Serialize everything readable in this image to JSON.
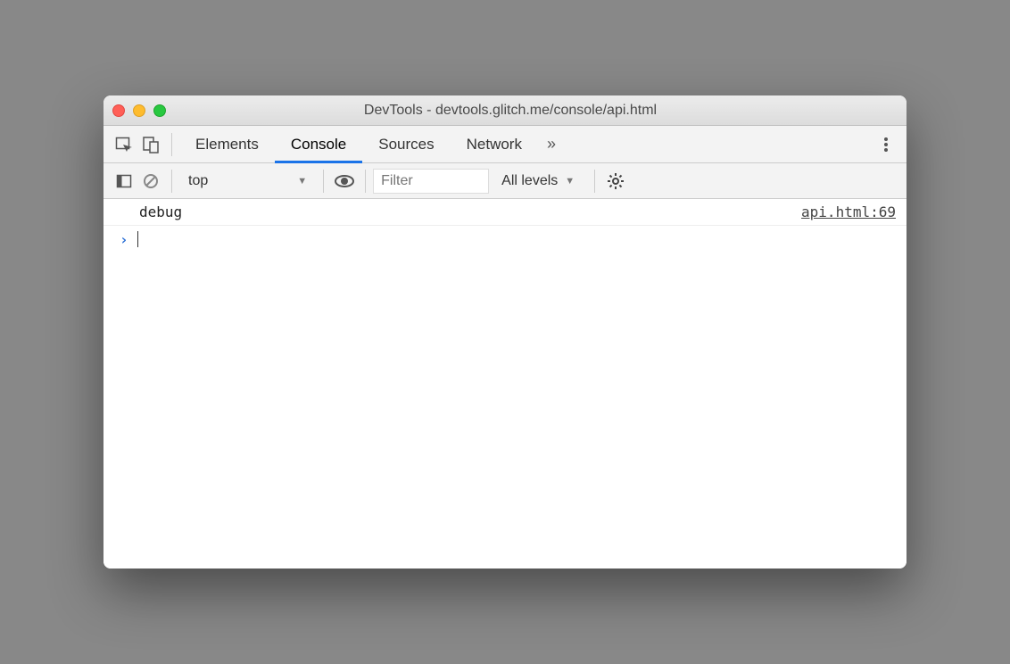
{
  "window": {
    "title": "DevTools - devtools.glitch.me/console/api.html"
  },
  "tabs": {
    "elements": "Elements",
    "console": "Console",
    "sources": "Sources",
    "network": "Network"
  },
  "subbar": {
    "context": "top",
    "filter_placeholder": "Filter",
    "levels": "All levels"
  },
  "log": {
    "message": "debug",
    "source": "api.html:69"
  }
}
